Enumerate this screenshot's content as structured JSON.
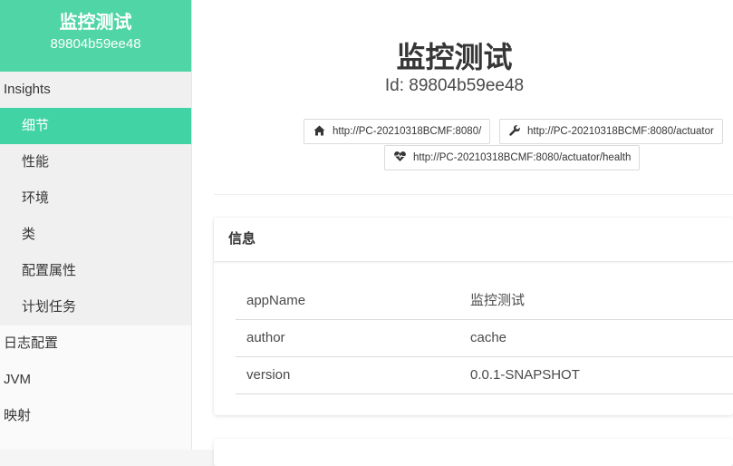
{
  "app": {
    "title": "监控测试",
    "id": "89804b59ee48"
  },
  "sidebar": {
    "group": {
      "label": "Insights",
      "items": [
        {
          "label": "细节",
          "active": true
        },
        {
          "label": "性能",
          "active": false
        },
        {
          "label": "环境",
          "active": false
        },
        {
          "label": "类",
          "active": false
        },
        {
          "label": "配置属性",
          "active": false
        },
        {
          "label": "计划任务",
          "active": false
        }
      ]
    },
    "top_items": [
      {
        "label": "日志配置"
      },
      {
        "label": "JVM"
      },
      {
        "label": "映射"
      }
    ]
  },
  "main": {
    "title": "监控测试",
    "id_line": "Id: 89804b59ee48",
    "links": {
      "home": {
        "text": "http://PC-20210318BCMF:8080/",
        "icon": "home-icon"
      },
      "actuator": {
        "text": "http://PC-20210318BCMF:8080/actuator",
        "icon": "wrench-icon"
      },
      "health": {
        "text": "http://PC-20210318BCMF:8080/actuator/health",
        "icon": "heartbeat-icon"
      }
    },
    "info_card": {
      "title": "信息",
      "rows": [
        {
          "key": "appName",
          "value": "监控测试"
        },
        {
          "key": "author",
          "value": "cache"
        },
        {
          "key": "version",
          "value": "0.0.1-SNAPSHOT"
        }
      ]
    }
  },
  "colors": {
    "accent": "#42d3a5",
    "header": "#4fd5a6"
  }
}
